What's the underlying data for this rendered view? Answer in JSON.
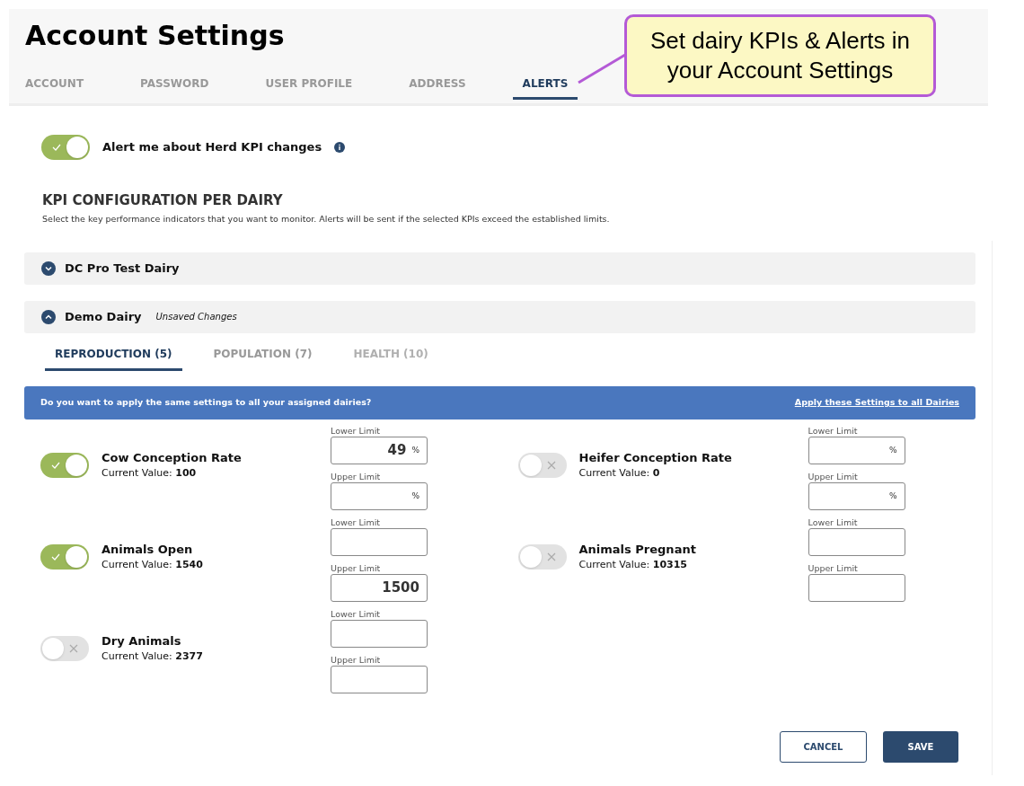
{
  "title": "Account Settings",
  "tabs": [
    {
      "label": "ACCOUNT",
      "selected": false
    },
    {
      "label": "PASSWORD",
      "selected": false
    },
    {
      "label": "USER PROFILE",
      "selected": false
    },
    {
      "label": "ADDRESS",
      "selected": false
    },
    {
      "label": "ALERTS",
      "selected": true
    }
  ],
  "callout": "Set dairy KPIs & Alerts in your Account Settings",
  "alert_toggle": {
    "label": "Alert me about Herd KPI changes",
    "on": true
  },
  "section": {
    "heading": "KPI CONFIGURATION PER DAIRY",
    "description": "Select the key performance indicators that you want to monitor. Alerts will be sent if the selected KPIs exceed the established limits."
  },
  "dairies": [
    {
      "name": "DC Pro Test Dairy",
      "expanded": false
    },
    {
      "name": "Demo Dairy",
      "expanded": true,
      "note": "Unsaved Changes"
    }
  ],
  "kpi_tabs": [
    {
      "label": "REPRODUCTION (5)",
      "selected": true,
      "disabled": false
    },
    {
      "label": "POPULATION (7)",
      "selected": false,
      "disabled": false
    },
    {
      "label": "HEALTH (10)",
      "selected": false,
      "disabled": true
    }
  ],
  "banner": {
    "question": "Do you want to apply the same settings to all your assigned dairies?",
    "link": "Apply these Settings to all Dairies"
  },
  "kpi_columns": [
    [
      {
        "name": "Cow Conception Rate",
        "on": true,
        "current_label": "Current Value:",
        "current_value": "100",
        "fields": [
          {
            "label": "Lower Limit",
            "value": "49",
            "unit": "%"
          },
          {
            "label": "Upper Limit",
            "unit": "%"
          }
        ]
      },
      {
        "name": "Animals Open",
        "on": true,
        "current_label": "Current Value:",
        "current_value": "1540",
        "fields": [
          {
            "label": "Lower Limit"
          },
          {
            "label": "Upper Limit",
            "value": "1500"
          }
        ]
      },
      {
        "name": "Dry Animals",
        "on": false,
        "current_label": "Current Value:",
        "current_value": "2377",
        "fields": [
          {
            "label": "Lower Limit"
          },
          {
            "label": "Upper Limit"
          }
        ]
      }
    ],
    [
      {
        "name": "Heifer Conception Rate",
        "on": false,
        "current_label": "Current Value:",
        "current_value": "0",
        "fields": [
          {
            "label": "Lower Limit",
            "unit": "%"
          },
          {
            "label": "Upper Limit",
            "unit": "%"
          }
        ]
      },
      {
        "name": "Animals Pregnant",
        "on": false,
        "current_label": "Current Value:",
        "current_value": "10315",
        "fields": [
          {
            "label": "Lower Limit"
          },
          {
            "label": "Upper Limit"
          }
        ]
      }
    ]
  ],
  "buttons": {
    "cancel": "CANCEL",
    "save": "SAVE"
  }
}
